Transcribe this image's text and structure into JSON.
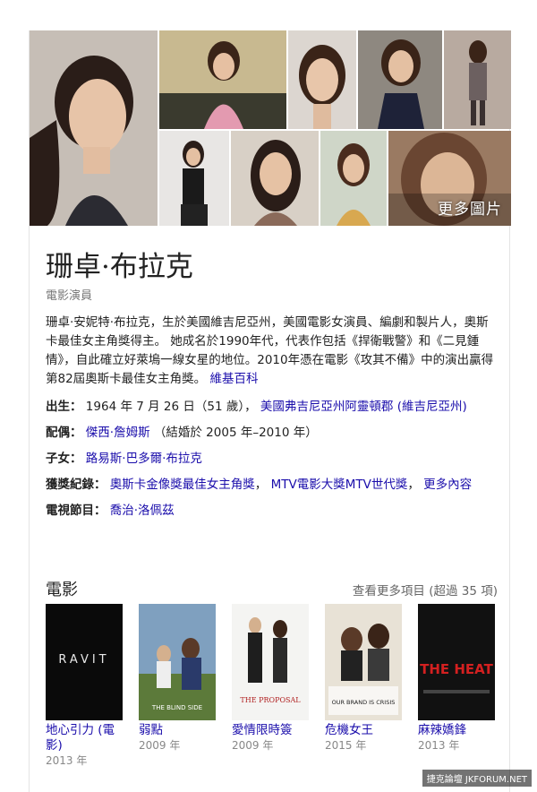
{
  "images": {
    "more_label": "更多圖片"
  },
  "entity": {
    "name": "珊卓·布拉克",
    "type": "電影演員",
    "description": "珊卓·安妮特·布拉克，生於美國維吉尼亞州，美國電影女演員、編劇和製片人，奧斯卡最佳女主角獎得主。 她成名於1990年代，代表作包括《捍衛戰警》和《二見鍾情》，自此確立好萊塢一線女星的地位。2010年憑在電影《攻其不備》中的演出贏得第82屆奧斯卡最佳女主角獎。",
    "source_link": "維基百科"
  },
  "facts": {
    "born": {
      "label": "出生：",
      "value": "1964 年 7 月 26 日（51 歲），",
      "link": "美國弗吉尼亞州阿靈頓郡 (維吉尼亞州)"
    },
    "spouse": {
      "label": "配偶：",
      "link": "傑西·詹姆斯",
      "value": "（結婚於 2005 年–2010 年）"
    },
    "children": {
      "label": "子女：",
      "link": "路易斯·巴多爾·布拉克"
    },
    "awards": {
      "label": "獲獎紀錄：",
      "link1": "奧斯卡金像獎最佳女主角獎",
      "sep1": "，",
      "link2": "MTV電影大獎MTV世代獎",
      "sep2": "，",
      "more": "更多內容"
    },
    "tv": {
      "label": "電視節目：",
      "link": "喬治·洛佩茲"
    }
  },
  "movies_section": {
    "title": "電影",
    "more": "查看更多項目 (超過 35 項)",
    "items": [
      {
        "title": "地心引力 (電影)",
        "year": "2013 年",
        "poster_text": "RAVIT"
      },
      {
        "title": "弱點",
        "year": "2009 年",
        "poster_text": "THE BLIND SIDE"
      },
      {
        "title": "愛情限時簽",
        "year": "2009 年",
        "poster_text": "THE PROPOSAL"
      },
      {
        "title": "危機女王",
        "year": "2015 年",
        "poster_text": "OUR BRAND IS CRISIS"
      },
      {
        "title": "麻辣嬌鋒",
        "year": "2013 年",
        "poster_text": "THE HEAT"
      }
    ]
  },
  "watermark": "捷克論壇 JKFORUM.NET",
  "colors": {
    "link": "#1a0dab",
    "muted": "#777777",
    "text": "#222222"
  }
}
